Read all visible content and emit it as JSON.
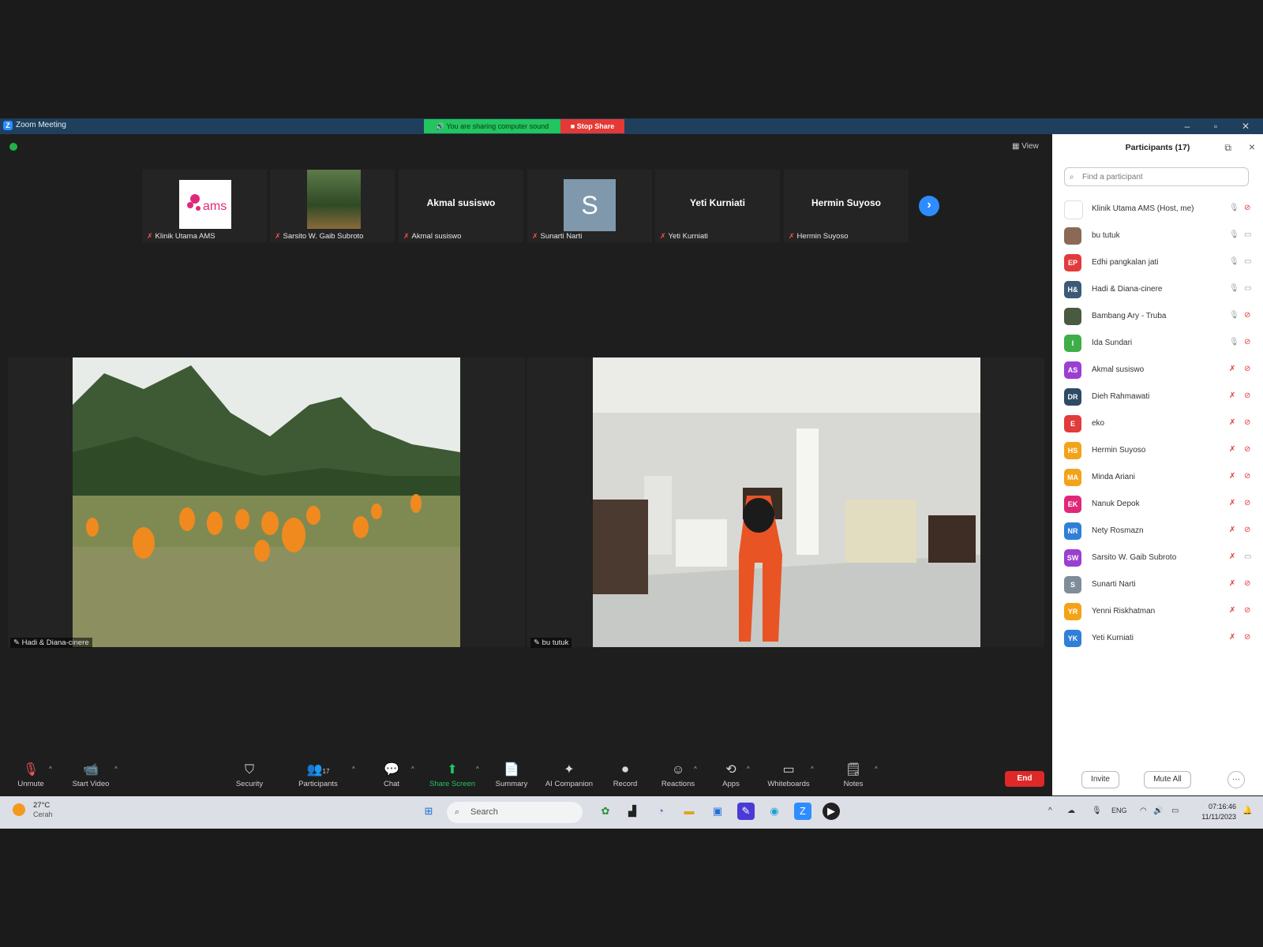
{
  "window": {
    "title": "Zoom Meeting",
    "logo": "Z",
    "sharing_banner": "You are sharing computer sound",
    "stop_share": "Stop Share",
    "controls": [
      "–",
      "▫",
      "✕"
    ]
  },
  "stage": {
    "view_label": "View",
    "strip": [
      {
        "label": "Klinik Utama AMS",
        "display": "logo",
        "logo_text": "ams"
      },
      {
        "label": "Sarsito W. Gaib Subroto",
        "display": "photo"
      },
      {
        "label": "Akmal susiswo",
        "display": "name",
        "name": "Akmal susiswo"
      },
      {
        "label": "Sunarti Narti",
        "display": "initial",
        "initial": "S"
      },
      {
        "label": "Yeti Kurniati",
        "display": "name",
        "name": "Yeti Kurniati"
      },
      {
        "label": "Hermin Suyoso",
        "display": "name",
        "name": "Hermin Suyoso"
      }
    ],
    "videos": [
      {
        "label": "Hadi & Diana-cinere"
      },
      {
        "label": "bu tutuk"
      }
    ]
  },
  "toolbar": {
    "unmute": "Unmute",
    "start_video": "Start Video",
    "security": "Security",
    "participants": "Participants",
    "participants_count": "17",
    "chat": "Chat",
    "share_screen": "Share Screen",
    "summary": "Summary",
    "ai_companion": "AI Companion",
    "record": "Record",
    "reactions": "Reactions",
    "apps": "Apps",
    "whiteboards": "Whiteboards",
    "notes": "Notes",
    "end": "End"
  },
  "panel": {
    "title": "Participants (17)",
    "search_placeholder": "Find a participant",
    "invite": "Invite",
    "mute_all": "Mute All",
    "more": "···",
    "participants": [
      {
        "name": "Klinik Utama AMS (Host, me)",
        "initials": "",
        "color": "#ffffff",
        "mic": "on",
        "cam": "off"
      },
      {
        "name": "bu tutuk",
        "initials": "",
        "color": "#8a6a55",
        "mic": "on",
        "cam": "on"
      },
      {
        "name": "Edhi pangkalan jati",
        "initials": "EP",
        "color": "#e23b3b",
        "mic": "on",
        "cam": "on"
      },
      {
        "name": "Hadi & Diana-cinere",
        "initials": "H&",
        "color": "#3c5a78",
        "mic": "on",
        "cam": "on"
      },
      {
        "name": "Bambang Ary - Truba",
        "initials": "",
        "color": "#4a5a40",
        "mic": "on",
        "cam": "off"
      },
      {
        "name": "Ida Sundari",
        "initials": "I",
        "color": "#3fae49",
        "mic": "on",
        "cam": "off"
      },
      {
        "name": "Akmal susiswo",
        "initials": "AS",
        "color": "#9b3fd0",
        "mic": "off",
        "cam": "off"
      },
      {
        "name": "Dieh Rahmawati",
        "initials": "DR",
        "color": "#2e4a66",
        "mic": "off",
        "cam": "off"
      },
      {
        "name": "eko",
        "initials": "E",
        "color": "#e23b3b",
        "mic": "off",
        "cam": "off"
      },
      {
        "name": "Hermin Suyoso",
        "initials": "HS",
        "color": "#f2a31a",
        "mic": "off",
        "cam": "off"
      },
      {
        "name": "Minda Ariani",
        "initials": "MA",
        "color": "#f2a31a",
        "mic": "off",
        "cam": "off"
      },
      {
        "name": "Nanuk Depok",
        "initials": "EK",
        "color": "#e0287a",
        "mic": "off",
        "cam": "off"
      },
      {
        "name": "Nety Rosmazn",
        "initials": "NR",
        "color": "#2f7fd6",
        "mic": "off",
        "cam": "off"
      },
      {
        "name": "Sarsito W. Gaib Subroto",
        "initials": "SW",
        "color": "#9b3fd0",
        "mic": "off",
        "cam": "on"
      },
      {
        "name": "Sunarti Narti",
        "initials": "S",
        "color": "#7f8c99",
        "mic": "off",
        "cam": "off"
      },
      {
        "name": "Yenni Riskhatman",
        "initials": "YR",
        "color": "#f2a31a",
        "mic": "off",
        "cam": "off"
      },
      {
        "name": "Yeti Kurniati",
        "initials": "YK",
        "color": "#2f7fd6",
        "mic": "off",
        "cam": "off"
      }
    ]
  },
  "taskbar": {
    "temperature": "27°C",
    "weather": "Cerah",
    "search": "Search",
    "language": "ENG",
    "time": "07:16:46",
    "date": "11/11/2023"
  }
}
